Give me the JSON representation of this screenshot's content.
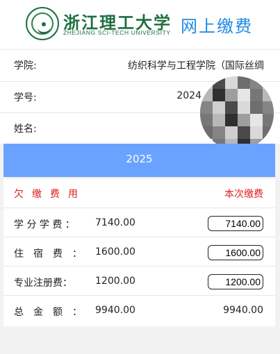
{
  "header": {
    "school_name_cn": "浙江理工大学",
    "school_name_en": "ZHEJIANG SCI-TECH UNIVERSITY",
    "page_title": "网上缴费",
    "brand_color": "#1f6f3f",
    "title_color": "#1e88e5"
  },
  "student": {
    "college_label": "学院:",
    "college_value": "纺织科学与工程学院（国际丝绸",
    "id_label": "学号:",
    "id_value": "2024",
    "name_label": "姓名:",
    "name_value": ""
  },
  "year_bar": {
    "label": "2025",
    "color": "#6aa3ff"
  },
  "fees": {
    "header_left": "欠缴费用",
    "header_right": "本次缴费",
    "accent_color": "#e02020",
    "items": [
      {
        "name": "学 分 学 费 ：",
        "due": "7140.00",
        "pay": "7140.00"
      },
      {
        "name": "住　宿　费　：",
        "due": "1600.00",
        "pay": "1600.00"
      },
      {
        "name": "专业注册费：",
        "due": "1200.00",
        "pay": "1200.00"
      }
    ],
    "total": {
      "name": "总　金　额　：",
      "due": "9940.00",
      "pay": "9940.00"
    }
  }
}
